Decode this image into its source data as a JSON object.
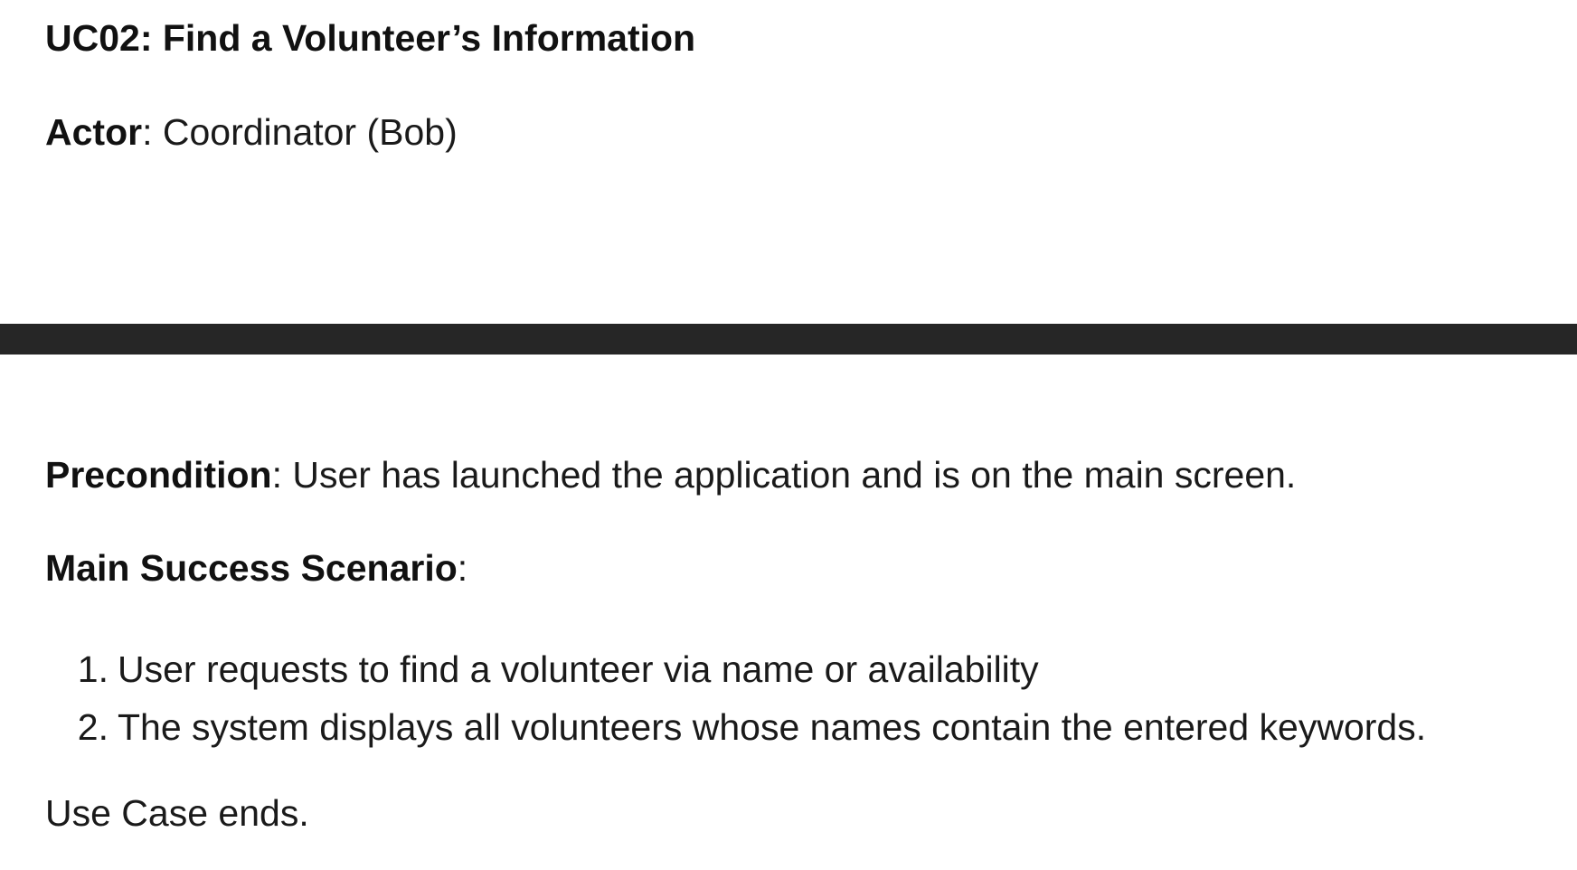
{
  "document": {
    "title": "UC02: Find a Volunteer’s Information",
    "actor": {
      "label": "Actor",
      "value": ": Coordinator (Bob)"
    },
    "precondition": {
      "label": "Precondition",
      "value": ": User has launched the application and is on the main screen."
    },
    "main_success_scenario": {
      "label": "Main Success Scenario",
      "suffix": ":",
      "steps": [
        {
          "number": "1.",
          "text": "User requests to find a volunteer via name or availability"
        },
        {
          "number": "2.",
          "text": "The system displays all volunteers whose names contain the entered keywords."
        }
      ]
    },
    "ending": "Use Case ends.",
    "divider_color": "#262626"
  }
}
